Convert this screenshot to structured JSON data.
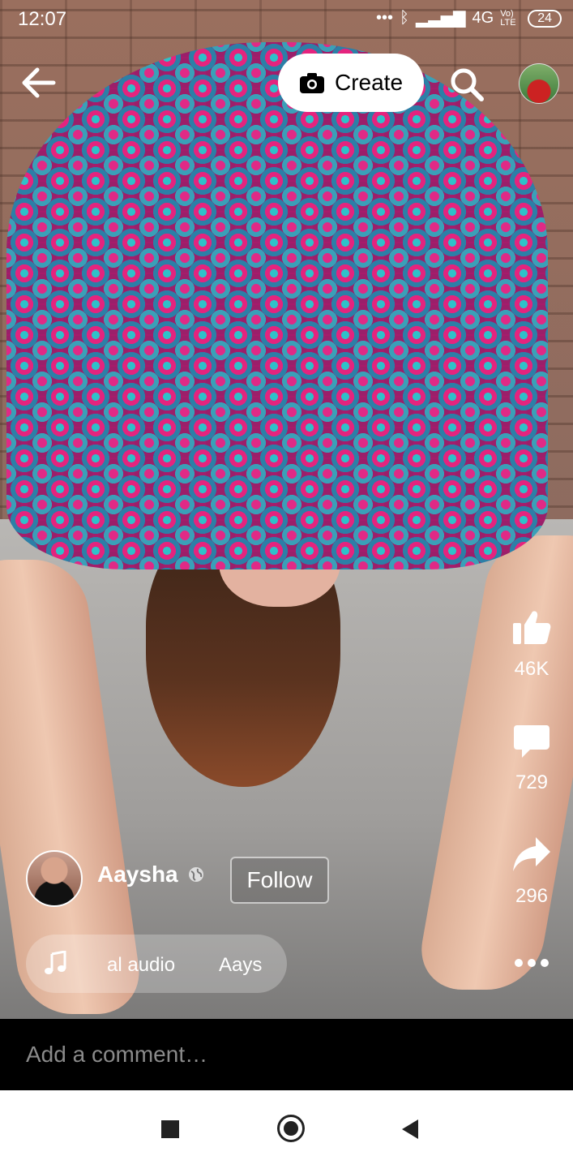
{
  "status_bar": {
    "time": "12:07",
    "signal": "4G",
    "volte": "Vo) LTE",
    "battery": "24"
  },
  "header": {
    "create_label": "Create"
  },
  "actions": {
    "likes": "46K",
    "comments": "729",
    "shares": "296"
  },
  "author": {
    "name": "Aaysha",
    "follow_label": "Follow"
  },
  "audio": {
    "title_part": "al audio",
    "artist_part": "Aays"
  },
  "comment": {
    "placeholder": "Add a comment…"
  },
  "colors": {
    "accent_white": "#ffffff",
    "comment_bar_bg": "#000000",
    "nav_bg": "#ffffff"
  },
  "icons": [
    "back-arrow-icon",
    "camera-icon",
    "search-icon",
    "thumbs-up-icon",
    "comment-bubble-icon",
    "share-arrow-icon",
    "more-dots-icon",
    "globe-icon",
    "music-note-icon"
  ]
}
